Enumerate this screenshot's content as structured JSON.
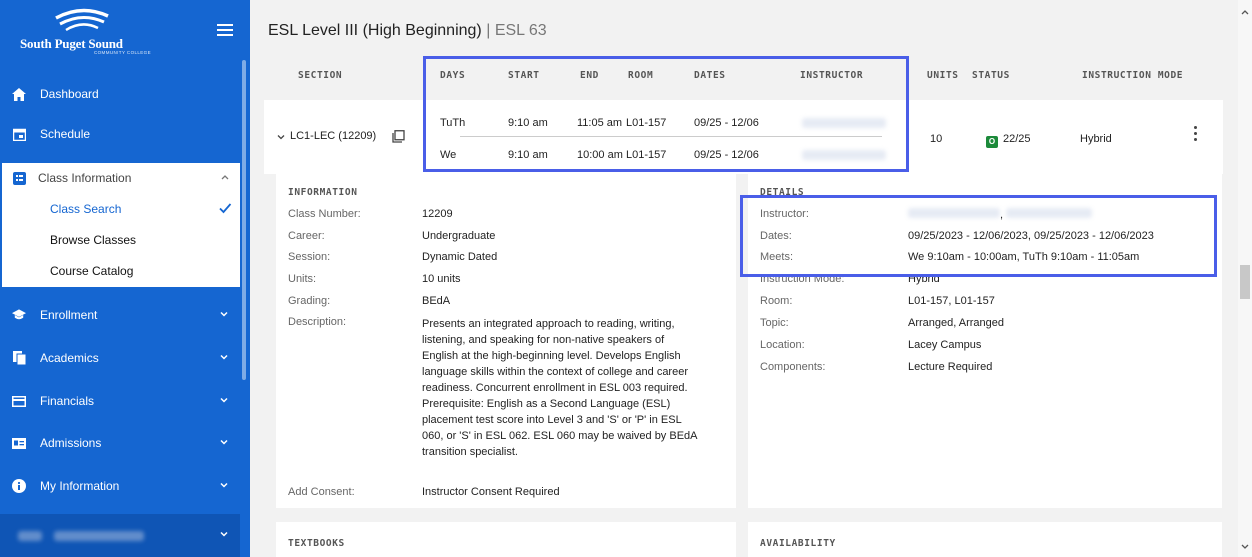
{
  "brand": {
    "name": "South Puget Sound",
    "sub": "COMMUNITY COLLEGE"
  },
  "sidebar": {
    "items": [
      {
        "label": "Dashboard",
        "icon": "home-icon"
      },
      {
        "label": "Schedule",
        "icon": "calendar-icon"
      },
      {
        "label": "Class Information",
        "icon": "class-info-icon"
      },
      {
        "label": "Enrollment",
        "icon": "graduation-cap-icon"
      },
      {
        "label": "Academics",
        "icon": "documents-icon"
      },
      {
        "label": "Financials",
        "icon": "credit-card-icon"
      },
      {
        "label": "Admissions",
        "icon": "id-card-icon"
      },
      {
        "label": "My Information",
        "icon": "info-icon"
      }
    ],
    "class_info_sub": [
      "Class Search",
      "Browse Classes",
      "Course Catalog"
    ]
  },
  "page": {
    "title": "ESL Level III (High Beginning)",
    "divider": "|",
    "code": "ESL 63"
  },
  "table": {
    "headers": [
      "SECTION",
      "DAYS",
      "START",
      "END",
      "ROOM",
      "DATES",
      "INSTRUCTOR",
      "UNITS",
      "STATUS",
      "INSTRUCTION MODE"
    ],
    "section": "LC1-LEC (12209)",
    "meetings": [
      {
        "days": "TuTh",
        "start": "9:10 am",
        "end": "11:05 am",
        "room": "L01-157",
        "dates": "09/25 - 12/06"
      },
      {
        "days": "We",
        "start": "9:10 am",
        "end": "10:00 am",
        "room": "L01-157",
        "dates": "09/25 - 12/06"
      }
    ],
    "units": "10",
    "status_badge": "O",
    "status": "22/25",
    "mode": "Hybrid"
  },
  "information": {
    "heading": "INFORMATION",
    "labels": [
      "Class Number:",
      "Career:",
      "Session:",
      "Units:",
      "Grading:",
      "Description:",
      "Add Consent:"
    ],
    "values": [
      "12209",
      "Undergraduate",
      "Dynamic Dated",
      "10 units",
      "BEdA"
    ],
    "description_lines": [
      "Presents an integrated approach to reading, writing,",
      "listening, and speaking for non-native speakers of",
      "English at the high-beginning level. Develops English",
      "language skills within the context of college and career",
      "readiness. Concurrent enrollment in ESL 003 required.",
      "Prerequisite: English as a Second Language (ESL)",
      "placement test score into Level 3 and 'S' or 'P' in ESL",
      "060, or 'S' in ESL 062. ESL 060 may be waived by BEdA",
      "transition specialist."
    ],
    "consent": "Instructor Consent Required"
  },
  "details": {
    "heading": "DETAILS",
    "labels": [
      "Instructor:",
      "Dates:",
      "Meets:",
      "Instruction Mode:",
      "Room:",
      "Topic:",
      "Location:",
      "Components:"
    ],
    "values": [
      "",
      "09/25/2023 - 12/06/2023, 09/25/2023 - 12/06/2023",
      "We 9:10am - 10:00am, TuTh 9:10am - 11:05am",
      "Hybrid",
      "L01-157, L01-157",
      "Arranged, Arranged",
      "Lacey Campus",
      "Lecture Required"
    ],
    "instructor_sep": ","
  },
  "sections_below": {
    "left": "TEXTBOOKS",
    "right": "AVAILABILITY"
  },
  "colors": {
    "sidebar": "#1566d1",
    "highlight": "#4a5ee8",
    "status_green": "#1c8a3a"
  }
}
